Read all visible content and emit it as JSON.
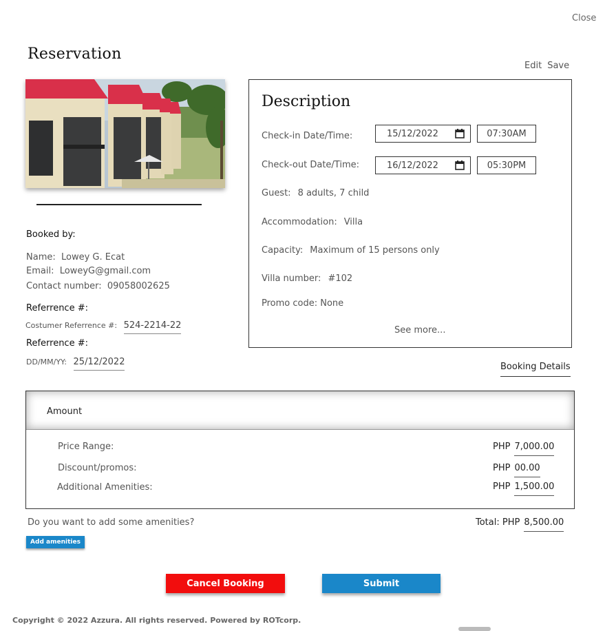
{
  "header": {
    "close_label": "Close",
    "title": "Reservation",
    "edit_label": "Edit",
    "save_label": "Save"
  },
  "booked_by": {
    "title": "Booked by:",
    "name_label": "Name:",
    "name_value": "Lowey G. Ecat",
    "email_label": "Email:",
    "email_value": "LoweyG@gmail.com",
    "contact_label": "Contact number:",
    "contact_value": "09058002625"
  },
  "reference": {
    "title1": "Referrence #:",
    "customer_ref_label": "Costumer Referrence #:",
    "customer_ref_value": "524-2214-22",
    "title2": "Referrence #:",
    "date_label": "DD/MM/YY:",
    "date_value": "25/12/2022"
  },
  "description": {
    "title": "Description",
    "checkin_label": "Check-in Date/Time:",
    "checkin_date": "15/12/2022",
    "checkin_time": "07:30AM",
    "checkout_label": "Check-out Date/Time:",
    "checkout_date": "16/12/2022",
    "checkout_time": "05:30PM",
    "guest_label": "Guest:",
    "guest_value": "8 adults, 7 child",
    "accommodation_label": "Accommodation:",
    "accommodation_value": "Villa",
    "capacity_label": "Capacity:",
    "capacity_value": "Maximum of 15 persons only",
    "villa_label": "Villa number:",
    "villa_value": "#102",
    "promo_text": "Promo code: None",
    "see_more": "See more..."
  },
  "booking_details_label": "Booking Details",
  "amount": {
    "title": "Amount",
    "currency": "PHP",
    "rows": [
      {
        "label": "Price Range:",
        "value": "7,000.00"
      },
      {
        "label": "Discount/promos:",
        "value": "00.00"
      },
      {
        "label": "Additional Amenities:",
        "value": "1,500.00"
      }
    ]
  },
  "amenities": {
    "question": "Do you want to add some amenities?",
    "button_label": "Add amenities"
  },
  "total": {
    "label": "Total:",
    "currency": "PHP",
    "value": "8,500.00"
  },
  "actions": {
    "cancel_label": "Cancel Booking",
    "submit_label": "Submit"
  },
  "footer": {
    "copyright": "Copyright © 2022 Azzura. All rights reserved. Powered by ROTcorp."
  },
  "colors": {
    "cancel": "#f20d0d",
    "primary": "#1a87c9",
    "roof": "#d9304a"
  },
  "icons": {
    "calendar": "calendar-icon"
  }
}
